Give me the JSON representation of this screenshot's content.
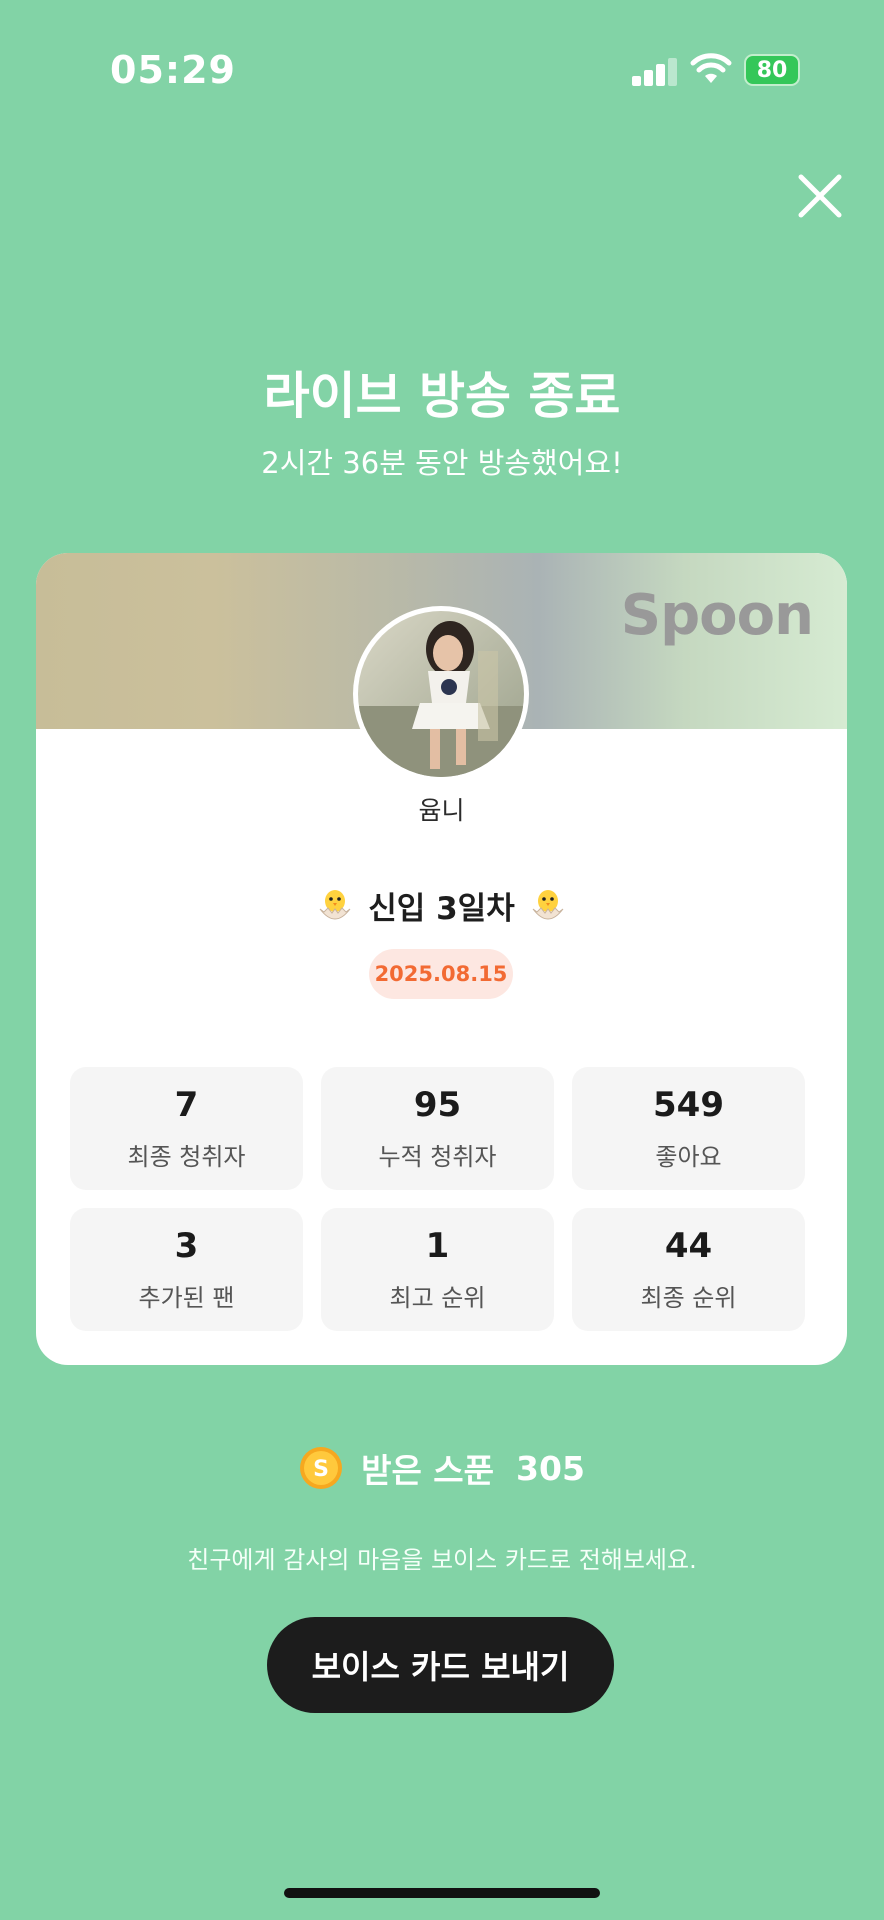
{
  "status_bar": {
    "time": "05:29",
    "battery": "80"
  },
  "header": {
    "title": "라이브 방송 종료",
    "subtitle": "2시간 36분 동안 방송했어요!"
  },
  "card": {
    "brand": "Spoon",
    "username": "윰니",
    "rank_label": "신입 3일차",
    "date": "2025.08.15",
    "stats": [
      {
        "value": "7",
        "label": "최종 청취자"
      },
      {
        "value": "95",
        "label": "누적 청취자"
      },
      {
        "value": "549",
        "label": "좋아요"
      },
      {
        "value": "3",
        "label": "추가된 팬"
      },
      {
        "value": "1",
        "label": "최고 순위"
      },
      {
        "value": "44",
        "label": "최종 순위"
      }
    ]
  },
  "spoons": {
    "label": "받은 스푼",
    "value": "305"
  },
  "hint": "친구에게 감사의 마음을 보이스 카드로 전해보세요.",
  "cta_label": "보이스 카드 보내기",
  "colors": {
    "background": "#82d3a6",
    "date_badge_text": "#f26a33",
    "cta_background": "#1c1c1c"
  },
  "icons": [
    "close-icon",
    "signal-icon",
    "wifi-icon",
    "battery-icon",
    "chick-icon",
    "coin-icon"
  ]
}
